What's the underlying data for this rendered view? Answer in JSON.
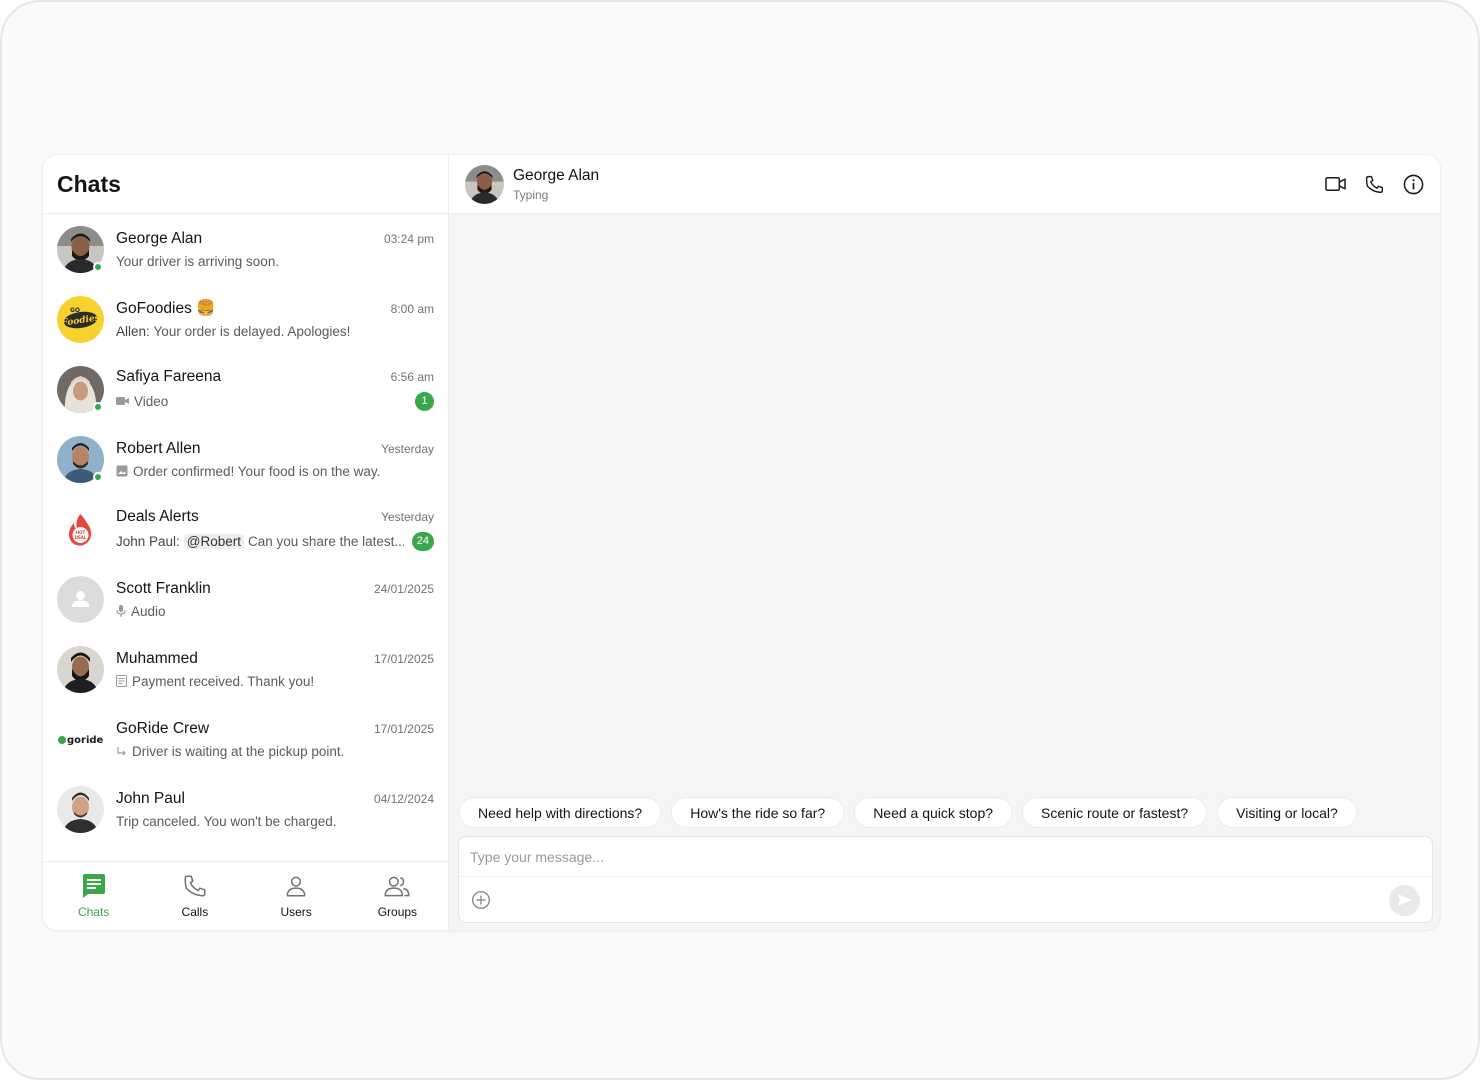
{
  "sidebar": {
    "title": "Chats",
    "chats": [
      {
        "name": "George Alan",
        "time": "03:24 pm",
        "preview": "Your driver is arriving soon.",
        "online": true,
        "avatar": "photo-man-beard"
      },
      {
        "name": "GoFoodies 🍔",
        "time": "8:00 am",
        "sender": "Allen:",
        "preview": "Your order is delayed. Apologies!",
        "avatar": "gofoodies-logo"
      },
      {
        "name": "Safiya Fareena",
        "time": "6:56 am",
        "preview": "Video",
        "preview_icon": "video-icon",
        "badge": "1",
        "online": true,
        "avatar": "photo-woman-hijab"
      },
      {
        "name": "Robert Allen",
        "time": "Yesterday",
        "preview": "Order confirmed! Your food is on the way.",
        "preview_icon": "image-icon",
        "online": true,
        "avatar": "photo-man-smiling"
      },
      {
        "name": "Deals Alerts",
        "time": "Yesterday",
        "sender": "John Paul:",
        "mention": "@Robert",
        "preview": "Can you share the latest...",
        "badge": "24",
        "avatar": "hot-deal-logo"
      },
      {
        "name": "Scott Franklin",
        "time": "24/01/2025",
        "preview": "Audio",
        "preview_icon": "mic-icon",
        "avatar": "default-user"
      },
      {
        "name": "Muhammed",
        "time": "17/01/2025",
        "preview": "Payment received. Thank you!",
        "preview_icon": "document-icon",
        "avatar": "photo-man-dark"
      },
      {
        "name": "GoRide Crew",
        "time": "17/01/2025",
        "preview": "Driver is waiting at the pickup point.",
        "preview_icon": "reply-icon",
        "avatar": "goride-logo"
      },
      {
        "name": "John Paul",
        "time": "04/12/2024",
        "preview": "Trip canceled. You won't be charged.",
        "avatar": "photo-man-light"
      }
    ],
    "nav": {
      "chats": "Chats",
      "calls": "Calls",
      "users": "Users",
      "groups": "Groups"
    }
  },
  "conversation": {
    "name": "George Alan",
    "status": "Typing",
    "suggestions": [
      "Need help with directions?",
      "How's the ride so far?",
      "Need a quick stop?",
      "Scenic route or fastest?",
      "Visiting or local?"
    ],
    "composer_placeholder": "Type your message..."
  },
  "colors": {
    "accent": "#3aa84a",
    "online": "#34a853",
    "background": "#f5f5f5"
  }
}
